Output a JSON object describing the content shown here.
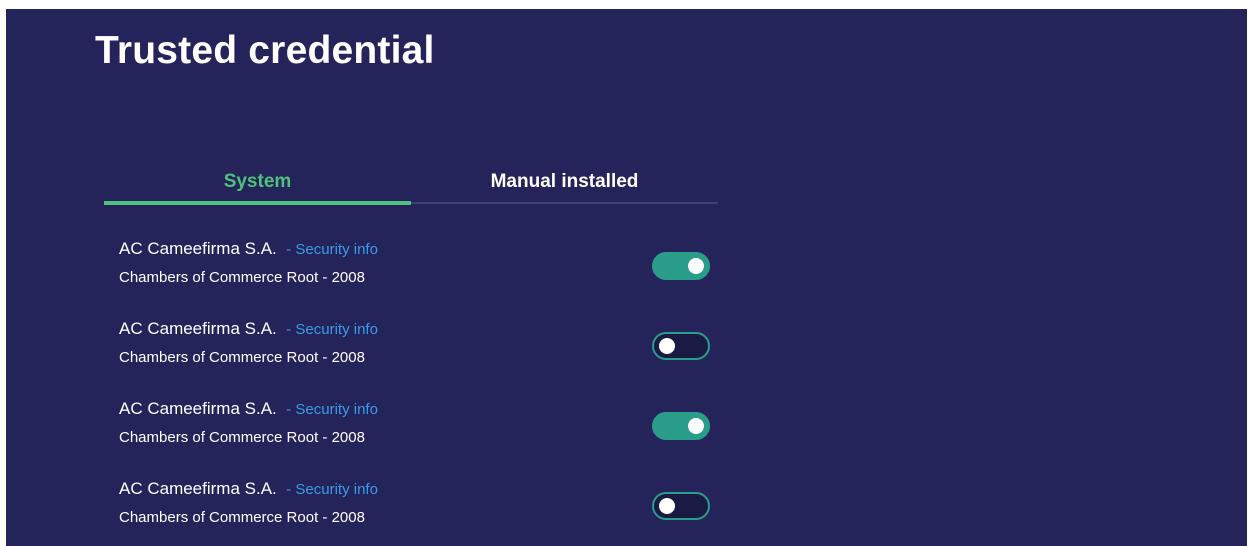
{
  "page": {
    "title": "Trusted credential"
  },
  "tabs": [
    {
      "label": "System",
      "active": true
    },
    {
      "label": "Manual installed",
      "active": false
    }
  ],
  "colors": {
    "background": "#25245a",
    "accent_green": "#4fc17c",
    "toggle_teal": "#2a9d8a",
    "link_blue": "#3a9be8"
  },
  "certificates": [
    {
      "name": "AC Cameefirma S.A.",
      "link": "- Security info",
      "subtitle": "Chambers of Commerce Root - 2008",
      "enabled": true
    },
    {
      "name": "AC Cameefirma S.A.",
      "link": "- Security info",
      "subtitle": "Chambers of Commerce Root - 2008",
      "enabled": false
    },
    {
      "name": "AC Cameefirma S.A.",
      "link": "- Security info",
      "subtitle": "Chambers of Commerce Root - 2008",
      "enabled": true
    },
    {
      "name": "AC Cameefirma S.A.",
      "link": "- Security info",
      "subtitle": "Chambers of Commerce Root - 2008",
      "enabled": false
    }
  ]
}
